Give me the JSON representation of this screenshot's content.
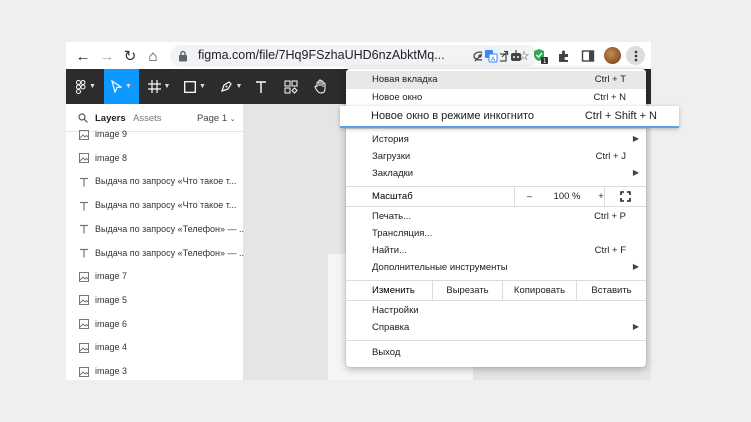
{
  "browser": {
    "url": "figma.com/file/7Hq9FSzhaUHD6nzAbktMq...",
    "nav": {
      "back": "←",
      "forward": "→",
      "reload": "↻",
      "home": "⌂"
    },
    "extensions": [
      "translate-icon",
      "robot-icon",
      "shield-check-icon",
      "puzzle-icon",
      "sidepanel-icon"
    ],
    "badge": "1"
  },
  "figma": {
    "tabs": {
      "layers": "Layers",
      "assets": "Assets",
      "page": "Page 1"
    },
    "layers": [
      {
        "icon": "image",
        "label": "image 9"
      },
      {
        "icon": "image",
        "label": "image 8"
      },
      {
        "icon": "text",
        "label": "Выдача по запросу «Что такое т..."
      },
      {
        "icon": "text",
        "label": "Выдача по запросу «Что такое т..."
      },
      {
        "icon": "text",
        "label": "Выдача по запросу «Телефон» — ..."
      },
      {
        "icon": "text",
        "label": "Выдача по запросу «Телефон» — ..."
      },
      {
        "icon": "image",
        "label": "image 7"
      },
      {
        "icon": "image",
        "label": "image 5"
      },
      {
        "icon": "image",
        "label": "image 6"
      },
      {
        "icon": "image",
        "label": "image 4"
      },
      {
        "icon": "image",
        "label": "image 3"
      }
    ]
  },
  "menu": {
    "new_tab": {
      "label": "Новая вкладка",
      "shortcut": "Ctrl + T"
    },
    "new_window": {
      "label": "Новое окно",
      "shortcut": "Ctrl + N"
    },
    "incognito": {
      "label": "Новое окно в режиме инкогнито",
      "shortcut": "Ctrl + Shift + N"
    },
    "history": {
      "label": "История"
    },
    "downloads": {
      "label": "Загрузки",
      "shortcut": "Ctrl + J"
    },
    "bookmarks": {
      "label": "Закладки"
    },
    "zoom": {
      "label": "Масштаб",
      "minus": "–",
      "value": "100 %",
      "plus": "+"
    },
    "print": {
      "label": "Печать...",
      "shortcut": "Ctrl + P"
    },
    "cast": {
      "label": "Трансляция..."
    },
    "find": {
      "label": "Найти...",
      "shortcut": "Ctrl + F"
    },
    "more_tools": {
      "label": "Дополнительные инструменты"
    },
    "edit": {
      "label": "Изменить",
      "cut": "Вырезать",
      "copy": "Копировать",
      "paste": "Вставить"
    },
    "settings": {
      "label": "Настройки"
    },
    "help": {
      "label": "Справка"
    },
    "exit": {
      "label": "Выход"
    }
  },
  "colors": {
    "accent": "#0d99ff",
    "toolbar": "#2c2c2c",
    "highlight_border": "#5aa0e6"
  }
}
